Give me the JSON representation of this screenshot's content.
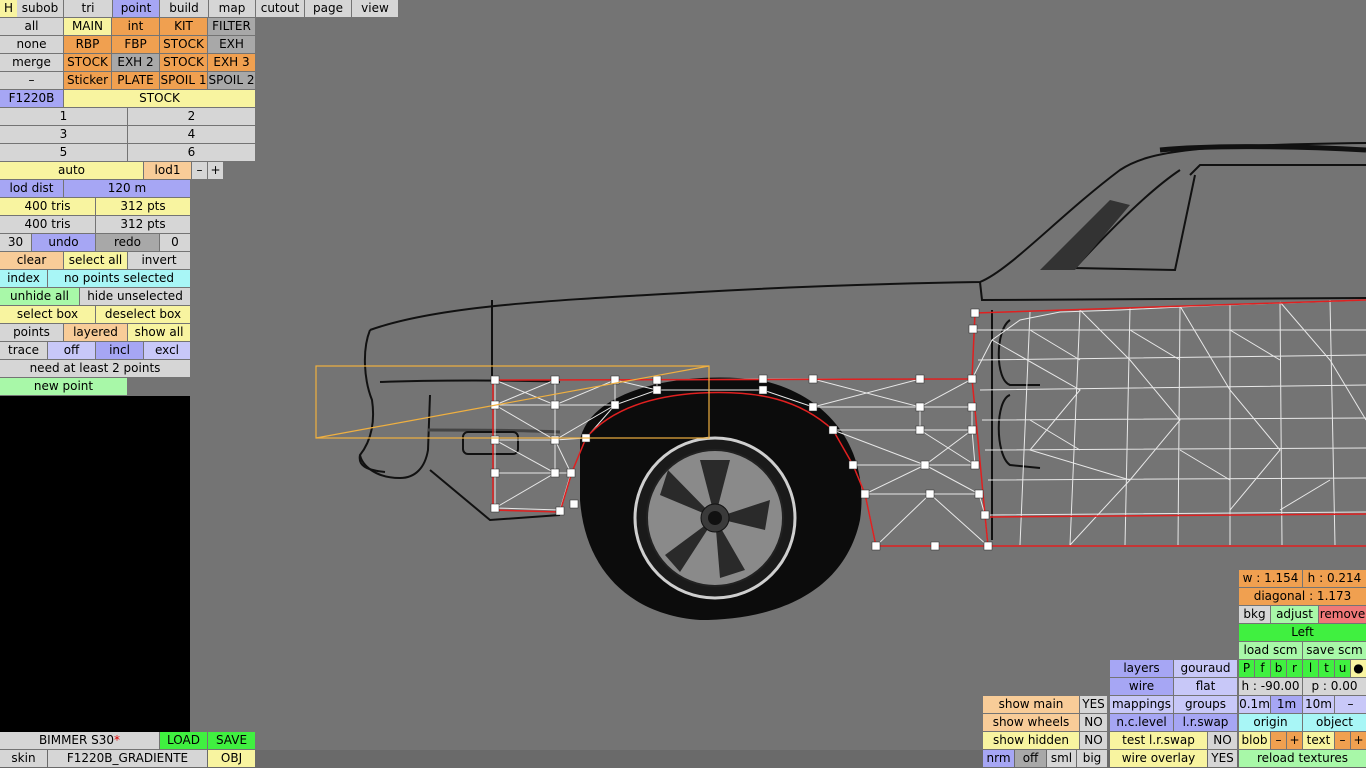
{
  "menubar": {
    "h": "H",
    "subob": "subob",
    "tri": "tri",
    "point": "point",
    "build": "build",
    "map": "map",
    "cutout": "cutout",
    "page": "page",
    "view": "view"
  },
  "parts": {
    "row1": [
      "all",
      "MAIN",
      "int",
      "KIT",
      "FILTER"
    ],
    "row2": [
      "none",
      "RBP",
      "FBP",
      "STOCK",
      "EXH"
    ],
    "row3": [
      "merge",
      "STOCK",
      "EXH 2",
      "STOCK",
      "EXH 3"
    ],
    "row4": [
      "–",
      "Sticker",
      "PLATE",
      "SPOIL 1",
      "SPOIL 2"
    ],
    "row5": [
      "F1220B",
      "STOCK"
    ],
    "nums": [
      "1",
      "2",
      "3",
      "4",
      "5",
      "6"
    ]
  },
  "lod": {
    "auto": "auto",
    "level": "lod1",
    "minus": "–",
    "plus": "+",
    "dist_label": "lod dist",
    "dist_value": "120 m",
    "tris1": "400 tris",
    "pts1": "312 pts",
    "tris2": "400 tris",
    "pts2": "312 pts"
  },
  "history": {
    "count": "30",
    "undo": "undo",
    "redo": "redo",
    "redo_count": "0"
  },
  "selection": {
    "clear": "clear",
    "select_all": "select all",
    "invert": "invert",
    "index": "index",
    "status": "no points selected",
    "unhide_all": "unhide all",
    "hide_unselected": "hide unselected",
    "select_box": "select box",
    "deselect_box": "deselect box",
    "points": "points",
    "layered": "layered",
    "show_all": "show all",
    "trace": "trace",
    "off": "off",
    "incl": "incl",
    "excl": "excl",
    "message": "need at least 2 points",
    "new_point": "new point"
  },
  "footer": {
    "car_name": "BIMMER S30",
    "modified_mark": "*",
    "load": "LOAD",
    "save": "SAVE",
    "skin": "skin",
    "skin_name": "F1220B_GRADIENTE",
    "obj": "OBJ"
  },
  "right_panel": {
    "w": "w : 1.154",
    "h": "h : 0.214",
    "diagonal": "diagonal : 1.173",
    "bkg": "bkg",
    "adjust": "adjust",
    "remove": "remove",
    "view": "Left",
    "load_scm": "load scm",
    "save_scm": "save scm",
    "layers_letters": [
      "P",
      "f",
      "b",
      "r",
      "l",
      "t",
      "u",
      "●"
    ],
    "h_angle": "h : -90.00",
    "p_angle": "p : 0.00",
    "step1": "0.1m",
    "step2": "1m",
    "step3": "10m",
    "step_minus": "–",
    "origin": "origin",
    "object": "object",
    "blob": "blob",
    "blob_minus": "–",
    "blob_plus": "+",
    "text": "text",
    "text_minus": "–",
    "text_plus": "+",
    "reload": "reload textures"
  },
  "render_panel": {
    "layers": "layers",
    "gouraud": "gouraud",
    "wire": "wire",
    "flat": "flat",
    "mappings": "mappings",
    "groups": "groups",
    "nc_level": "n.c.level",
    "lr_swap": "l.r.swap",
    "test_lr_swap": "test l.r.swap",
    "test_lr_swap_val": "NO",
    "wire_overlay": "wire overlay",
    "wire_overlay_val": "YES"
  },
  "show_panel": {
    "main": "show main",
    "main_val": "YES",
    "wheels": "show wheels",
    "wheels_val": "NO",
    "hidden": "show hidden",
    "hidden_val": "NO",
    "nrm": "nrm",
    "off": "off",
    "sml": "sml",
    "big": "big"
  },
  "colors": {
    "background": "#747474",
    "selected_blue": "#a6a6f4",
    "orange": "#f0a050",
    "yellow": "#f8f4a0",
    "green": "#40f040",
    "wire_red": "#e02020",
    "select_box": "#f0b040"
  }
}
